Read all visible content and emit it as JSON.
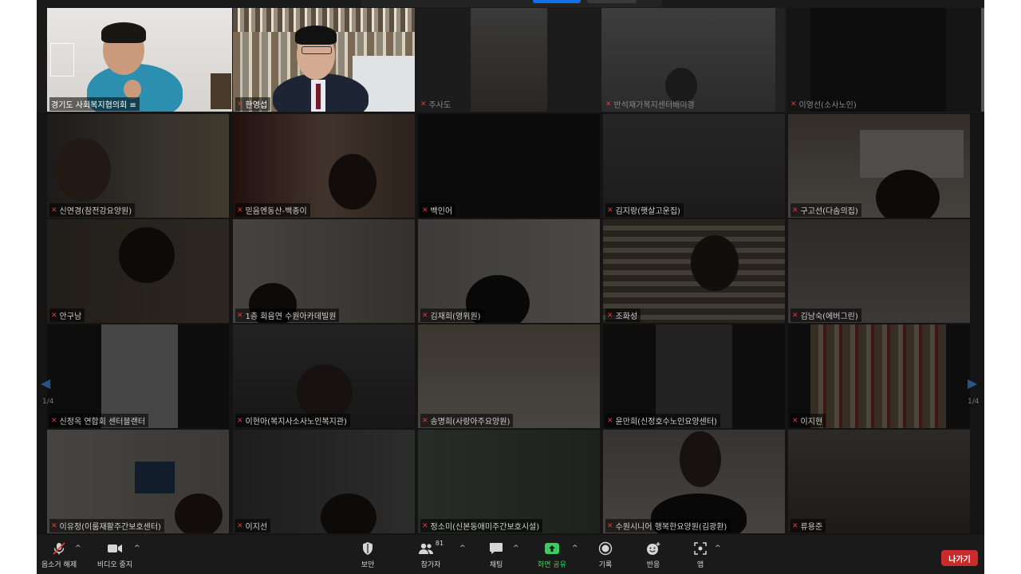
{
  "participants": [
    {
      "name": "경기도 사회복지협의회 ≡",
      "muted": false
    },
    {
      "name": "한영섭",
      "muted": true
    },
    {
      "name": "주사도",
      "muted": true
    },
    {
      "name": "반석재가복지센터배미경",
      "muted": true
    },
    {
      "name": "이영선(소사노인)",
      "muted": true
    },
    {
      "name": "신연경(참전강요양원)",
      "muted": true
    },
    {
      "name": "믿음엔동산-백종이",
      "muted": true
    },
    {
      "name": "백인어",
      "muted": true
    },
    {
      "name": "김지랑(햇살고운집)",
      "muted": true
    },
    {
      "name": "구고선(다솜의집)",
      "muted": true
    },
    {
      "name": "안구남",
      "muted": true
    },
    {
      "name": "1층 회음연 수원아카데빌원",
      "muted": true
    },
    {
      "name": "김재희(영위원)",
      "muted": true
    },
    {
      "name": "조화성",
      "muted": true
    },
    {
      "name": "김남숙(에버그린)",
      "muted": true
    },
    {
      "name": "신정옥 연합회 센터블랜터",
      "muted": true
    },
    {
      "name": "이현아(복지사소사노인복지관)",
      "muted": true
    },
    {
      "name": "송명희(사랑아주요양원)",
      "muted": true
    },
    {
      "name": "윤만희(신정호수노인요양센터)",
      "muted": true
    },
    {
      "name": "이지현",
      "muted": true
    },
    {
      "name": "이유정(이룸재활주간보호센터)",
      "muted": true
    },
    {
      "name": "이지선",
      "muted": true
    },
    {
      "name": "정소미(신본동애미주간보호시설)",
      "muted": true
    },
    {
      "name": "수원시니어 행복한요양원(김광환)",
      "muted": true
    },
    {
      "name": "류용준",
      "muted": true
    }
  ],
  "nav": {
    "page_left": "1/4",
    "page_right": "1/4"
  },
  "toolbar": {
    "unmute": "음소거 해제",
    "stop_video": "비디오 중지",
    "security": "보안",
    "participants": "참가자",
    "participants_count": "81",
    "chat": "채팅",
    "share_screen": "화면 공유",
    "record": "기록",
    "reactions": "반응",
    "apps": "앱",
    "leave": "나가기"
  },
  "colors": {
    "active_speaker": "#d9df4f",
    "leave": "#c92b2b",
    "share": "#3ccb5c",
    "muted_mic": "#e0383e"
  }
}
